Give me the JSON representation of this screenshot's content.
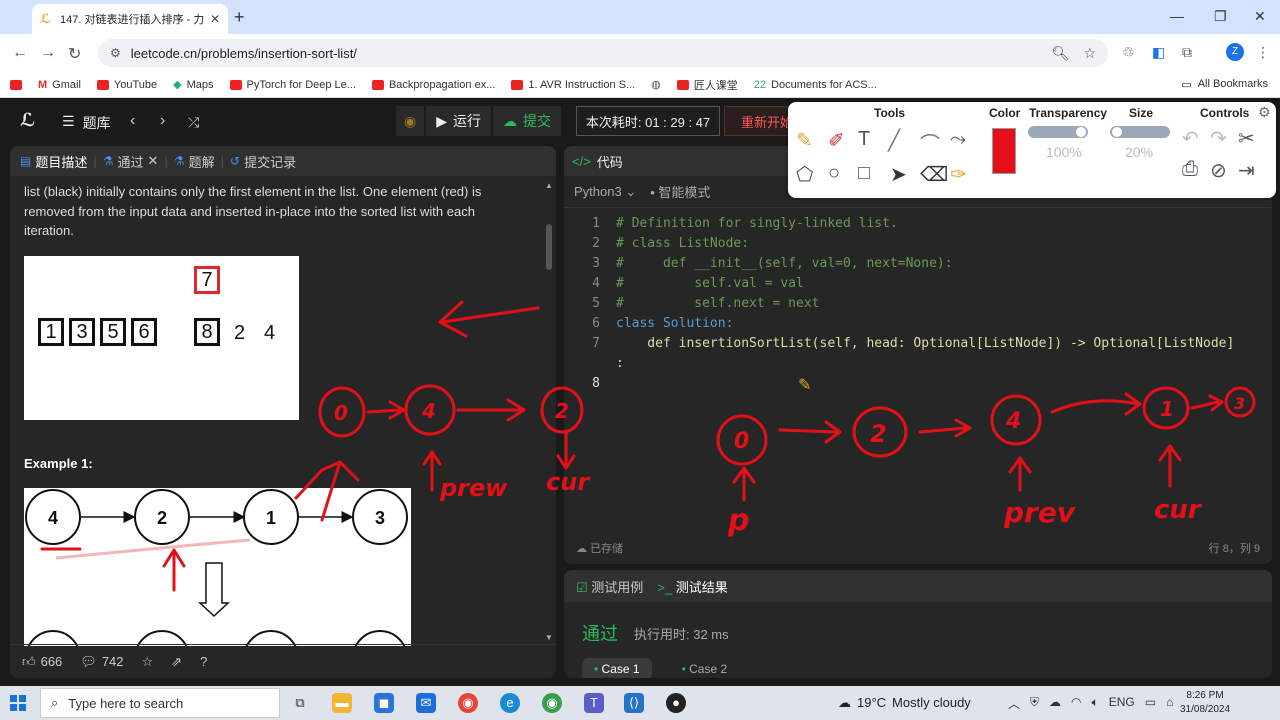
{
  "browser": {
    "tab_title": "147. 对链表进行插入排序 - 力扣",
    "url": "leetcode.cn/problems/insertion-sort-list/",
    "bookmarks": [
      "Gmail",
      "YouTube",
      "Maps",
      "PyTorch for Deep Le...",
      "Backpropagation ex...",
      "1. AVR Instruction S...",
      "匠人课堂",
      "Documents for ACS..."
    ],
    "all_bookmarks": "All Bookmarks",
    "avatar": "Z"
  },
  "lc_header": {
    "problem_list": "题库",
    "run": "运行",
    "submit": "提交",
    "timer": "本次耗时: 01 : 29 : 47",
    "restart": "重新开始"
  },
  "left_panel": {
    "tabs": [
      "题目描述",
      "通过",
      "题解",
      "提交记录"
    ],
    "description": "list (black) initially contains only the first element in the list. One element (red) is removed from the input data and inserted in-place into the sorted list with each iteration.",
    "fig1": {
      "sorted": [
        "1",
        "3",
        "5",
        "6"
      ],
      "picked": "7",
      "current": "8",
      "rest": [
        "2",
        "4"
      ]
    },
    "example_title": "Example 1:",
    "fig2_nodes": [
      "4",
      "2",
      "1",
      "3"
    ],
    "likes": "666",
    "comments": "742"
  },
  "code_panel": {
    "title": "代码",
    "language": "Python3",
    "mode": "智能模式",
    "lines": [
      {
        "n": "1",
        "t": "# Definition for singly-linked list."
      },
      {
        "n": "2",
        "t": "# class ListNode:"
      },
      {
        "n": "3",
        "t": "#     def __init__(self, val=0, next=None):"
      },
      {
        "n": "4",
        "t": "#         self.val = val"
      },
      {
        "n": "5",
        "t": "#         self.next = next"
      },
      {
        "n": "6",
        "t": "class Solution:"
      },
      {
        "n": "7",
        "t": "    def insertionSortList(self, head: Optional[ListNode]) -> Optional[ListNode]"
      },
      {
        "n": "",
        "t": ":"
      },
      {
        "n": "8",
        "t": ""
      }
    ],
    "saved": "已存储",
    "position": "行 8，列 9"
  },
  "bottom_panel": {
    "tab_testcase": "测试用例",
    "tab_result": "测试结果",
    "status": "通过",
    "runtime": "执行用时: 32 ms",
    "cases": [
      "Case 1",
      "Case 2"
    ]
  },
  "draw_tool": {
    "sections": [
      "Tools",
      "Color",
      "Transparency",
      "Size",
      "Controls"
    ],
    "transparency": "100%",
    "size": "20%",
    "color": "#e3101a"
  },
  "taskbar": {
    "search_placeholder": "Type here to search",
    "temp": "19°C",
    "weather": "Mostly cloudy",
    "lang": "ENG",
    "time": "8:26 PM",
    "date": "31/08/2024"
  },
  "annotations": {
    "prev_left": "prew",
    "cur_left": "cur",
    "p_right": "p",
    "prev_right": "prev",
    "cur_right": "cur",
    "circles_left": [
      "0",
      "4",
      "2"
    ],
    "circles_right": [
      "0",
      "2",
      "4",
      "1",
      "3"
    ]
  }
}
